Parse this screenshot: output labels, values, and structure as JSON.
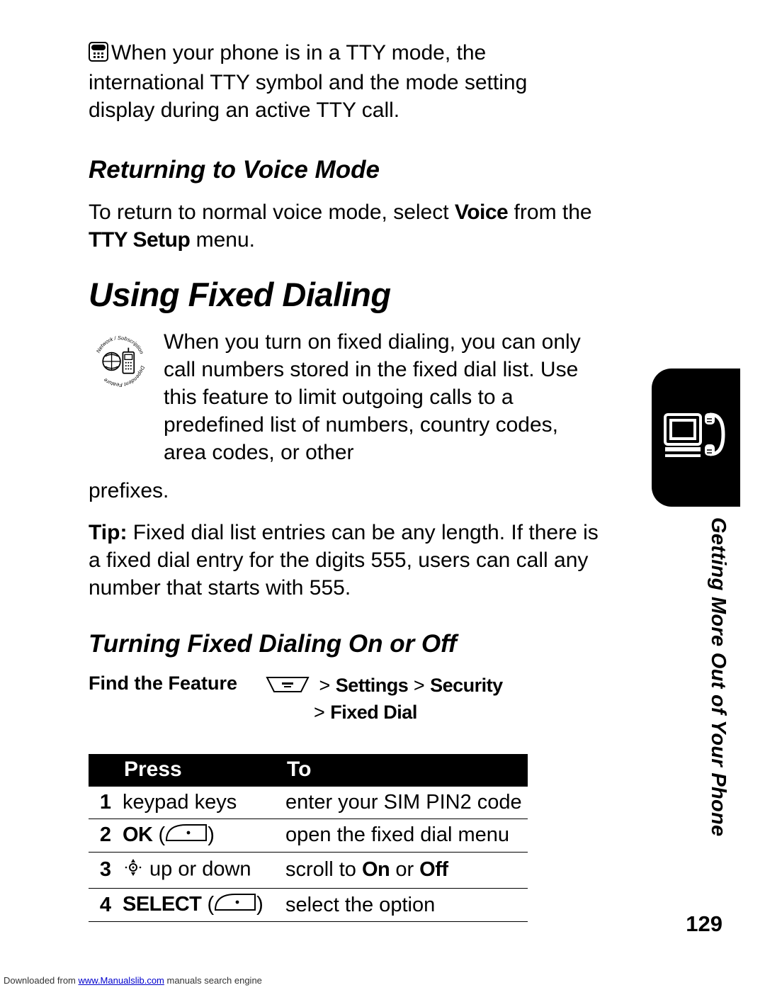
{
  "intro": {
    "text": "When your phone is in a TTY mode, the international TTY symbol and the mode setting display during an active TTY call.",
    "icon_name": "tty-icon"
  },
  "section_return": {
    "heading": "Returning to Voice Mode",
    "body_before": "To return to normal voice mode, select ",
    "voice_label": "Voice",
    "body_mid": " from the ",
    "tty_setup_label": "TTY Setup",
    "body_after": " menu."
  },
  "main_heading": "Using Fixed Dialing",
  "fixed_dial": {
    "callout_icon": "network-subscription-dependent-feature-icon",
    "callout_text": "When you turn on fixed dialing, you can only call numbers stored in the fixed dial list. Use this feature to limit outgoing calls to a predefined list of numbers, country codes, area codes, or other",
    "callout_wrap": "prefixes.",
    "tip_label": "Tip:",
    "tip_body": " Fixed dial list entries can be any length. If there is a fixed dial entry for the digits 555, users can call any number that starts with 555."
  },
  "turning_heading": "Turning Fixed Dialing On or Off",
  "find_feature": {
    "label": "Find the Feature",
    "menu_icon": "menu-key-icon",
    "path_line1_a": "> ",
    "path_line1_b": "Settings",
    "gt1": " > ",
    "path_line1_c": "Security",
    "path_line2_a": "> ",
    "path_line2_b": "Fixed Dial"
  },
  "table": {
    "headers": {
      "press": "Press",
      "to": "To"
    },
    "rows": [
      {
        "n": "1",
        "press_text": "keypad keys",
        "to": "enter your SIM PIN2 code"
      },
      {
        "n": "2",
        "press_bold": "OK",
        "open": " (",
        "close": ")",
        "icon": "right-softkey-icon",
        "to": "open the fixed dial menu"
      },
      {
        "n": "3",
        "icon": "nav-key-icon",
        "press_text": " up or down",
        "to_pre": "scroll to ",
        "to_b1": "On",
        "to_mid": " or ",
        "to_b2": "Off"
      },
      {
        "n": "4",
        "press_bold": "SELECT",
        "open": " (",
        "close": ")",
        "icon": "right-softkey-icon",
        "to": "select the option"
      }
    ]
  },
  "side_tab": {
    "icon": "computer-phone-icon",
    "label": "Getting More Out of Your Phone"
  },
  "page_number": "129",
  "footer": {
    "pre": "Downloaded from ",
    "link": "www.Manualslib.com",
    "post": " manuals search engine"
  }
}
